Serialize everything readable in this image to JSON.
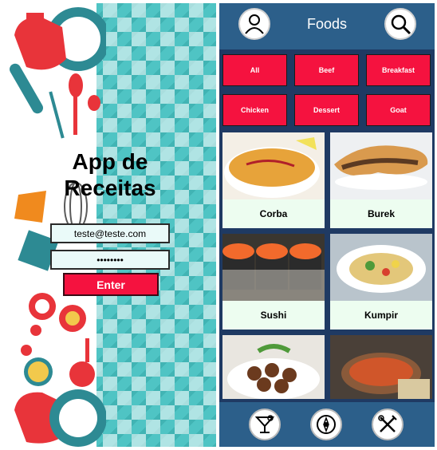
{
  "login": {
    "title_line1": "App de",
    "title_line2": "Receitas",
    "email_value": "teste@teste.com",
    "password_value": "••••••••",
    "enter_label": "Enter"
  },
  "foods": {
    "header": {
      "title": "Foods",
      "profile_icon": "profile-icon",
      "search_icon": "search-icon"
    },
    "categories": [
      "All",
      "Beef",
      "Breakfast",
      "Chicken",
      "Dessert",
      "Goat"
    ],
    "recipes": [
      {
        "name": "Corba"
      },
      {
        "name": "Burek"
      },
      {
        "name": "Sushi"
      },
      {
        "name": "Kumpir"
      },
      {
        "name": ""
      },
      {
        "name": ""
      }
    ],
    "bottom_nav": [
      "drinks-icon",
      "explore-icon",
      "food-icon"
    ]
  },
  "colors": {
    "accent": "#f5123f",
    "header_bg": "#2c5f8a",
    "page_bg": "#1f3a63",
    "card_bg": "#edfdf0",
    "teal": "#4fc4c4"
  }
}
